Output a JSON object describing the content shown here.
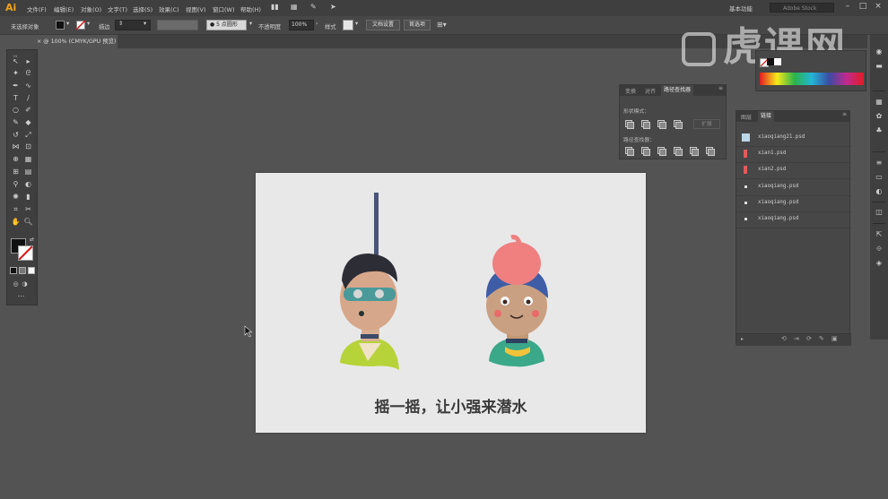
{
  "menubar": {
    "logo": "Ai",
    "items": [
      "文件(F)",
      "编辑(E)",
      "对象(O)",
      "文字(T)",
      "选择(S)",
      "效果(C)",
      "视图(V)",
      "窗口(W)",
      "帮助(H)"
    ],
    "workspace": "基本功能",
    "search_placeholder": "Adobe Stock"
  },
  "controlbar": {
    "selection_label": "未选择对象",
    "stroke_label": "描边",
    "brush_label": "5 点圆形",
    "opacity_label": "不透明度",
    "opacity_value": "100%",
    "style_label": "样式",
    "doc_setup_button": "文档设置",
    "preferences_button": "首选项"
  },
  "document": {
    "tab_title": "@ 100% (CMYK/GPU 预览)"
  },
  "artboard": {
    "caption": "摇一摇，让小强来潜水"
  },
  "pathfinder_panel": {
    "tabs": [
      "变换",
      "对齐",
      "路径查找器"
    ],
    "active_tab": 2,
    "shape_modes_label": "形状模式：",
    "expand_button": "扩展",
    "pathfinders_label": "路径查找器："
  },
  "links_panel": {
    "tabs": [
      "图层",
      "链接"
    ],
    "active_tab": 1,
    "items": [
      {
        "name": "xiaoqiang21.psd",
        "thumb": "light"
      },
      {
        "name": "xian1.psd",
        "thumb": "red"
      },
      {
        "name": "xian2.psd",
        "thumb": "red"
      },
      {
        "name": "xiaoqiang.psd",
        "thumb": "dot"
      },
      {
        "name": "xiaoqiang.psd",
        "thumb": "dot"
      },
      {
        "name": "xiaoqiang.psd",
        "thumb": "dot"
      }
    ]
  },
  "watermark": {
    "text": "虎课网"
  },
  "colors": {
    "app_bg": "#535353",
    "panel_bg": "#474747",
    "accent": "#f0a21b"
  }
}
